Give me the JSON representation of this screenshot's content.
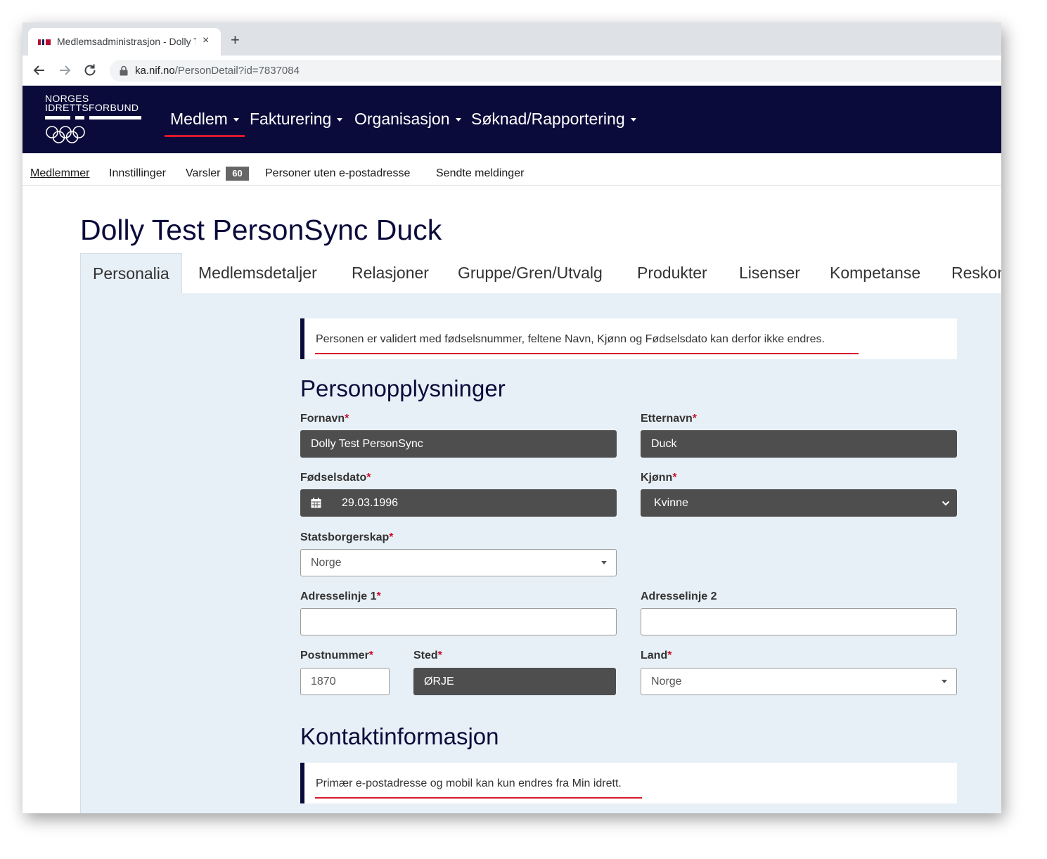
{
  "browser": {
    "tab_title": "Medlemsadministrasjon - Dolly Test",
    "new_tab": "+",
    "close": "×",
    "url_host": "ka.nif.no",
    "url_path": "/PersonDetail?id=7837084"
  },
  "header": {
    "logo_line1": "NORGES",
    "logo_line2": "IDRETTSFORBUND",
    "nav": [
      {
        "label": "Medlem"
      },
      {
        "label": "Fakturering"
      },
      {
        "label": "Organisasjon"
      },
      {
        "label": "Søknad/Rapportering"
      }
    ]
  },
  "subnav": {
    "items": [
      "Medlemmer",
      "Innstillinger",
      "Varsler",
      "Personer uten e-postadresse",
      "Sendte meldinger"
    ],
    "varsler_count": "60"
  },
  "page": {
    "title": "Dolly Test PersonSync Duck",
    "tabs": [
      "Personalia",
      "Medlemsdetaljer",
      "Relasjoner",
      "Gruppe/Gren/Utvalg",
      "Produkter",
      "Lisenser",
      "Kompetanse",
      "Reskontro"
    ]
  },
  "form": {
    "alert_validated": "Personen er validert med fødselsnummer, feltene Navn, Kjønn og Fødselsdato kan derfor ikke endres.",
    "section_personal": "Personopplysninger",
    "required_mark": "*",
    "fornavn_label": "Fornavn",
    "fornavn_value": "Dolly Test PersonSync",
    "etternavn_label": "Etternavn",
    "etternavn_value": "Duck",
    "fodselsdato_label": "Fødselsdato",
    "fodselsdato_value": "29.03.1996",
    "kjonn_label": "Kjønn",
    "kjonn_value": "Kvinne",
    "statsborgerskap_label": "Statsborgerskap",
    "statsborgerskap_value": "Norge",
    "adresse1_label": "Adresselinje 1",
    "adresse1_value": "",
    "adresse2_label": "Adresselinje 2",
    "adresse2_value": "",
    "postnummer_label": "Postnummer",
    "postnummer_value": "1870",
    "sted_label": "Sted",
    "sted_value": "ØRJE",
    "land_label": "Land",
    "land_value": "Norge",
    "section_contact": "Kontaktinformasjon",
    "alert_contact": "Primær e-postadresse og mobil kan kun endres fra Min idrett."
  },
  "colors": {
    "brand_navy": "#0b0b3b",
    "accent_red": "#d7192b",
    "panel_bg": "#e8f0f7",
    "readonly_field": "#4e4e4e"
  }
}
